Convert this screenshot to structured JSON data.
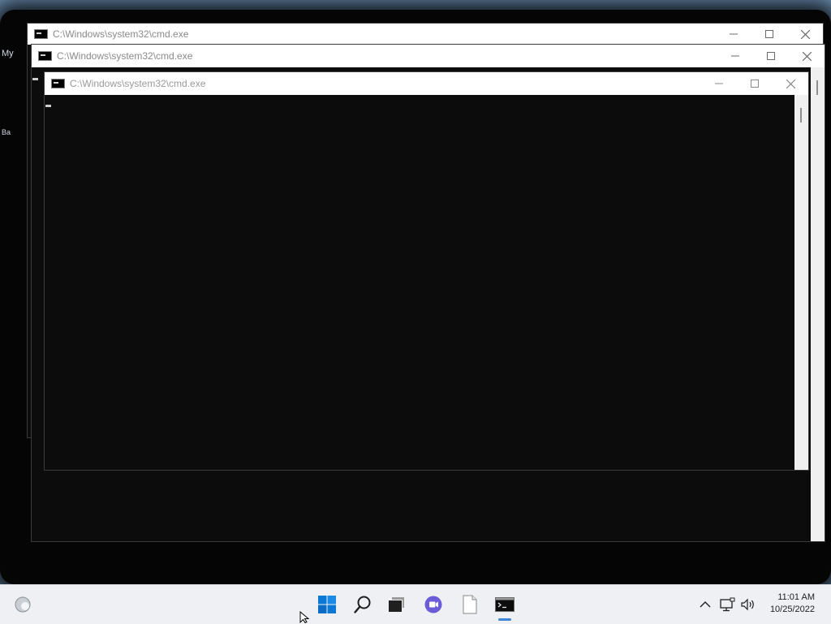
{
  "windows": [
    {
      "title": "C:\\Windows\\system32\\cmd.exe"
    },
    {
      "title": "C:\\Windows\\system32\\cmd.exe"
    },
    {
      "title": "C:\\Windows\\system32\\cmd.exe"
    }
  ],
  "desktop": {
    "label_top": "My",
    "label_bottom": "Ba"
  },
  "taskbar": {
    "time": "11:01 AM",
    "date": "10/25/2022"
  },
  "icons": {
    "window": "cmd-icon",
    "minimize": "minimize-icon",
    "maximize": "maximize-icon",
    "close": "close-icon",
    "start": "windows-start-icon",
    "search": "search-icon",
    "task_view": "task-view-icon",
    "chat": "teams-chat-icon",
    "notepad": "notepad-icon",
    "terminal": "cmd-taskbar-icon",
    "widgets": "widgets-icon",
    "chevron": "chevron-up-icon",
    "network": "network-icon",
    "volume": "volume-icon"
  },
  "colors": {
    "console_bg": "#0c0c0c",
    "titlebar_bg": "#ffffff",
    "taskbar_bg": "#eef0f3",
    "accent": "#0078d4"
  }
}
